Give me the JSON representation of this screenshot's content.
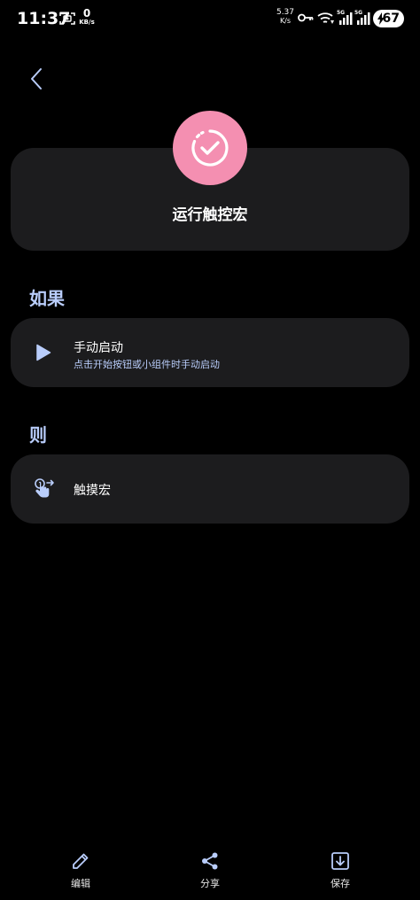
{
  "status_bar": {
    "time": "11:37",
    "net_speed_left_value": "0",
    "net_speed_left_unit": "KB/s",
    "net_speed_right_value": "5.37",
    "net_speed_right_unit": "K/s",
    "signal1_label": "5G",
    "signal2_label": "5G",
    "battery": "67"
  },
  "header": {
    "title": "运行触控宏",
    "icon": "check-timer-icon",
    "icon_bg": "#f48fb1"
  },
  "sections": {
    "if_label": "如果",
    "then_label": "则"
  },
  "trigger": {
    "title": "手动启动",
    "subtitle": "点击开始按钮或小组件时手动启动",
    "icon": "play-icon"
  },
  "action": {
    "title": "触摸宏",
    "icon": "touch-gesture-icon"
  },
  "bottom_bar": {
    "edit_label": "编辑",
    "share_label": "分享",
    "save_label": "保存"
  },
  "colors": {
    "background": "#000000",
    "card": "#1c1c1e",
    "accent": "#b9cdfb",
    "header_icon": "#f48fb1"
  }
}
